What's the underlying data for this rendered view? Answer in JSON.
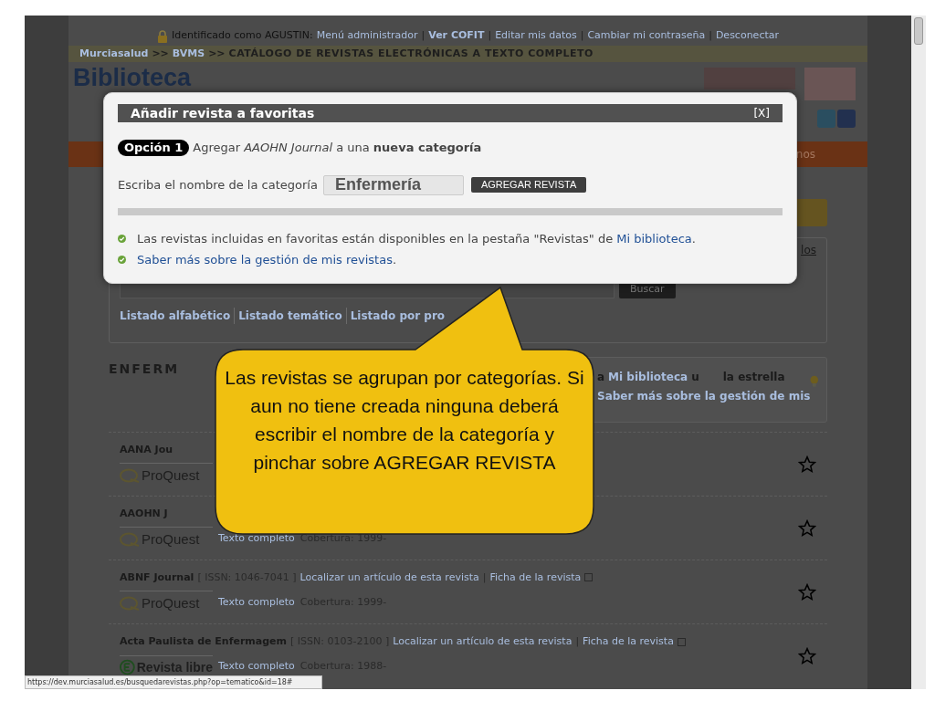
{
  "top_bar": {
    "user_text": "Identificado como AGUSTIN:",
    "separator": "|",
    "links": [
      {
        "label": "Menú administrador",
        "bold": false
      },
      {
        "label": "Ver COFIT",
        "bold": true
      },
      {
        "label": "Editar mis datos",
        "bold": false
      },
      {
        "label": "Cambiar mi contraseña",
        "bold": false
      },
      {
        "label": "Desconectar",
        "bold": false
      }
    ]
  },
  "breadcrumb": {
    "separator": ">>",
    "items": [
      {
        "label": "Murciasalud",
        "link": true
      },
      {
        "label": "BVMS",
        "link": true
      },
      {
        "label": "CATÁLOGO DE REVISTAS ELECTRÓNICAS A TEXTO COMPLETO",
        "link": false
      }
    ]
  },
  "header": {
    "title": "Biblioteca"
  },
  "nav_bar": {
    "visible_text": "nos"
  },
  "search_panel": {
    "visible_link": "los",
    "button": "Buscar",
    "links": [
      "Listado alfabético",
      "Listado temático",
      "Listado por pro"
    ]
  },
  "section": {
    "title": "ENFERM"
  },
  "info_box": {
    "before": "a",
    "link": "Mi biblioteca",
    "after": "u",
    "tail": "la estrella",
    "link_2": "Saber más sobre la gestión de mis"
  },
  "rows": [
    {
      "name": "AANA Jou",
      "kind": "proquest",
      "provider_label": "ProQuest"
    },
    {
      "name": "AAOHN J",
      "kind": "proquest",
      "provider_label": "ProQuest",
      "fulltext": "Texto completo",
      "coverage": "Cobertura: 1999-"
    },
    {
      "name": "ABNF Journal",
      "issn": "[ ISSN: 1046-7041 ]",
      "locate": "Localizar un artículo de esta revista",
      "separator": "|",
      "record": "Ficha de la revista",
      "kind": "proquest",
      "provider_label": "ProQuest",
      "fulltext": "Texto completo",
      "coverage": "Cobertura: 1999-"
    },
    {
      "name": "Acta Paulista de Enfermagem",
      "issn": "[ ISSN: 0103-2100 ]",
      "locate": "Localizar un artículo de esta revista",
      "separator": "|",
      "record": "Ficha de la revista",
      "kind": "libre",
      "provider_label": "Revista libre",
      "fulltext": "Texto completo",
      "coverage": "Cobertura: 1988-"
    }
  ],
  "status_bar": {
    "url": "https://dev.murciasalud.es/busquedarevistas.php?op=tematico&id=18#"
  },
  "modal": {
    "title": "Añadir revista a favoritas",
    "close": "[X]",
    "option_badge": "Opción 1",
    "option_text": "Agregar *AAOHN Journal* a una **nueva categoría**",
    "field_label": "Escriba el nombre de la categoría",
    "field_value": "Enfermería",
    "button": "AGREGAR REVISTA",
    "progress": {
      "level": 0
    },
    "notes": [
      {
        "text": "Las revistas incluidas en favoritas están disponibles en la pestaña \"Revistas\" de ",
        "link": "Mi biblioteca",
        "after": "."
      },
      {
        "link": "Saber más sobre la gestión de mis revistas",
        "after": "."
      }
    ]
  },
  "callout": {
    "text": "Las revistas se agrupan por categorías. Si aun no tiene creada ninguna deberá escribir el nombre de la categoría y pinchar sobre AGREGAR REVISTA"
  }
}
